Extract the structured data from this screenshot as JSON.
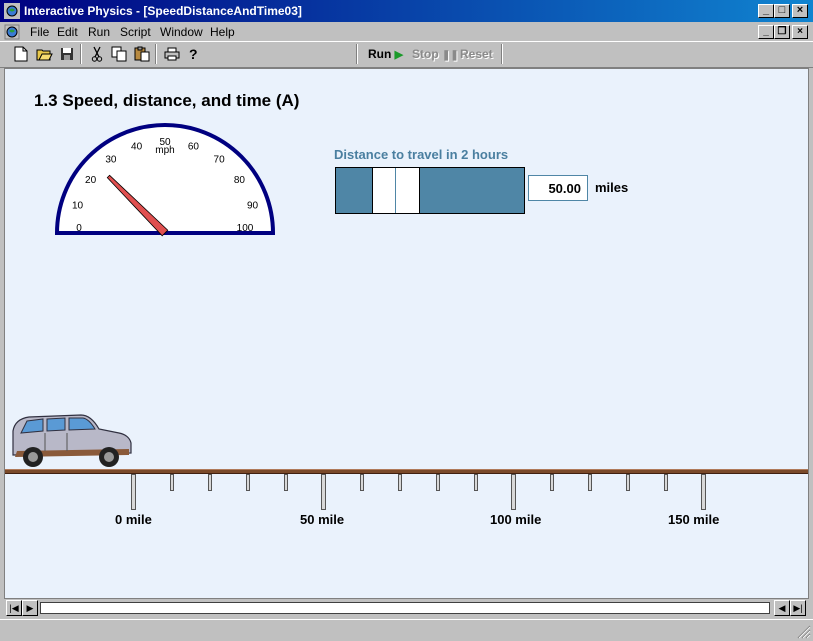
{
  "window": {
    "title": "Interactive Physics - [SpeedDistanceAndTime03]",
    "caption_buttons": [
      "minimize",
      "maximize",
      "close"
    ]
  },
  "menubar": {
    "items": [
      {
        "label": "File",
        "key": "F"
      },
      {
        "label": "Edit",
        "key": "E"
      },
      {
        "label": "Run",
        "key": "R"
      },
      {
        "label": "Script",
        "key": "S"
      },
      {
        "label": "Window",
        "key": "W"
      },
      {
        "label": "Help",
        "key": "H"
      }
    ]
  },
  "toolbar": {
    "icons": [
      "new-file-icon",
      "open-folder-icon",
      "save-disk-icon",
      "cut-scissors-icon",
      "copy-icon",
      "paste-clipboard-icon",
      "print-icon",
      "help-question-icon"
    ],
    "run_label": "Run",
    "stop_label": "Stop",
    "reset_label": "Reset"
  },
  "page": {
    "title": "1.3 Speed, distance, and time (A)"
  },
  "speedometer": {
    "unit": "mph",
    "ticks": [
      "0",
      "10",
      "20",
      "30",
      "40",
      "50",
      "60",
      "70",
      "80",
      "90",
      "100"
    ],
    "reading": 25,
    "max": 100
  },
  "distance_control": {
    "label": "Distance to travel in 2 hours",
    "value": "50.00",
    "unit": "miles",
    "fraction": 0.25
  },
  "road": {
    "labels": [
      "0 mile",
      "50 mile",
      "100 mile",
      "150 mile"
    ]
  },
  "colors": {
    "titlebar": "#000080",
    "canvas_bg": "#eaf2fc",
    "slider": "#4f86a6",
    "gauge_rim": "#000080",
    "needle": "#e05050",
    "road": "#7a4a2a"
  }
}
